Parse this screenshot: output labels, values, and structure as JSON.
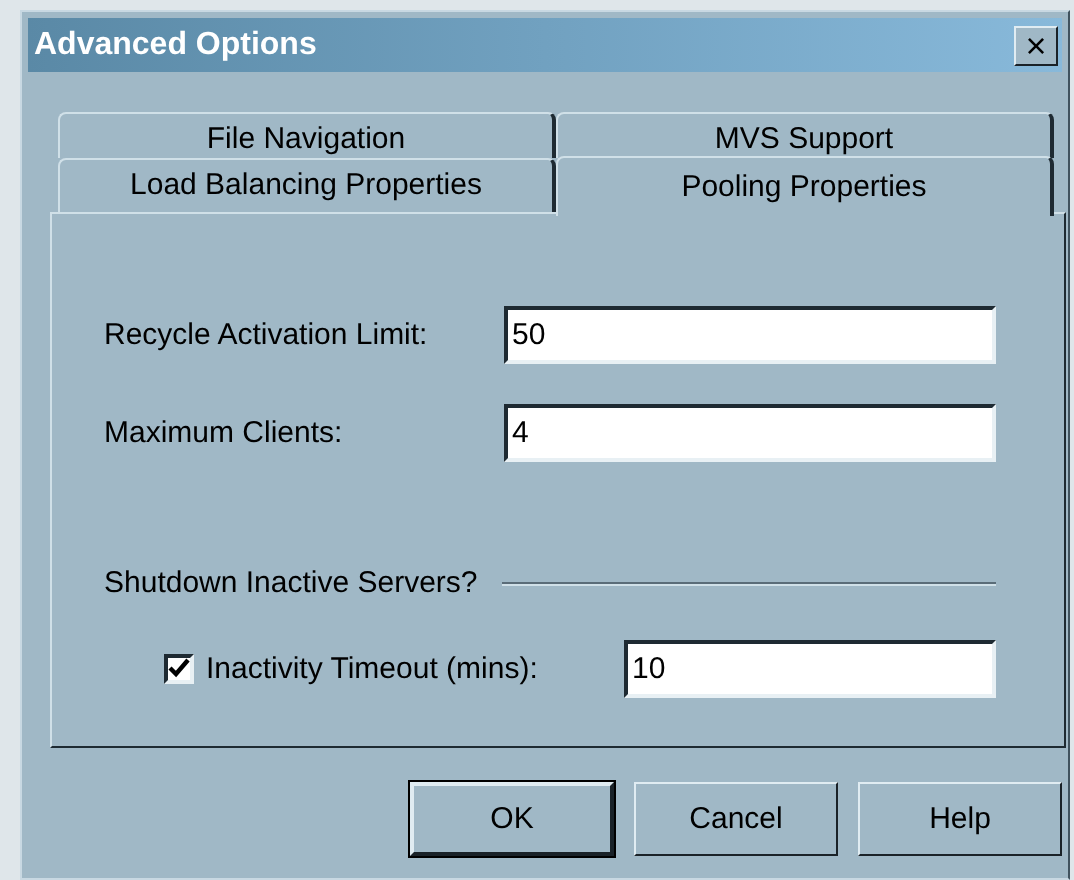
{
  "window": {
    "title": "Advanced Options",
    "close": "×"
  },
  "tab_rows": [
    [
      {
        "label": "File Navigation",
        "selected": false
      },
      {
        "label": "MVS Support",
        "selected": false
      }
    ],
    [
      {
        "label": "Load Balancing Properties",
        "selected": false
      },
      {
        "label": "Pooling Properties",
        "selected": true
      }
    ]
  ],
  "fields": [
    {
      "label": "Recycle Activation Limit:",
      "value": "50"
    },
    {
      "label": "Maximum Clients:",
      "value": "4"
    }
  ],
  "group": {
    "title": "Shutdown Inactive Servers?",
    "option": {
      "label": "Inactivity Timeout (mins):",
      "checked": true,
      "value": "10"
    }
  },
  "buttons": [
    {
      "label": "OK",
      "default": true
    },
    {
      "label": "Cancel",
      "default": false
    },
    {
      "label": "Help",
      "default": false
    }
  ]
}
